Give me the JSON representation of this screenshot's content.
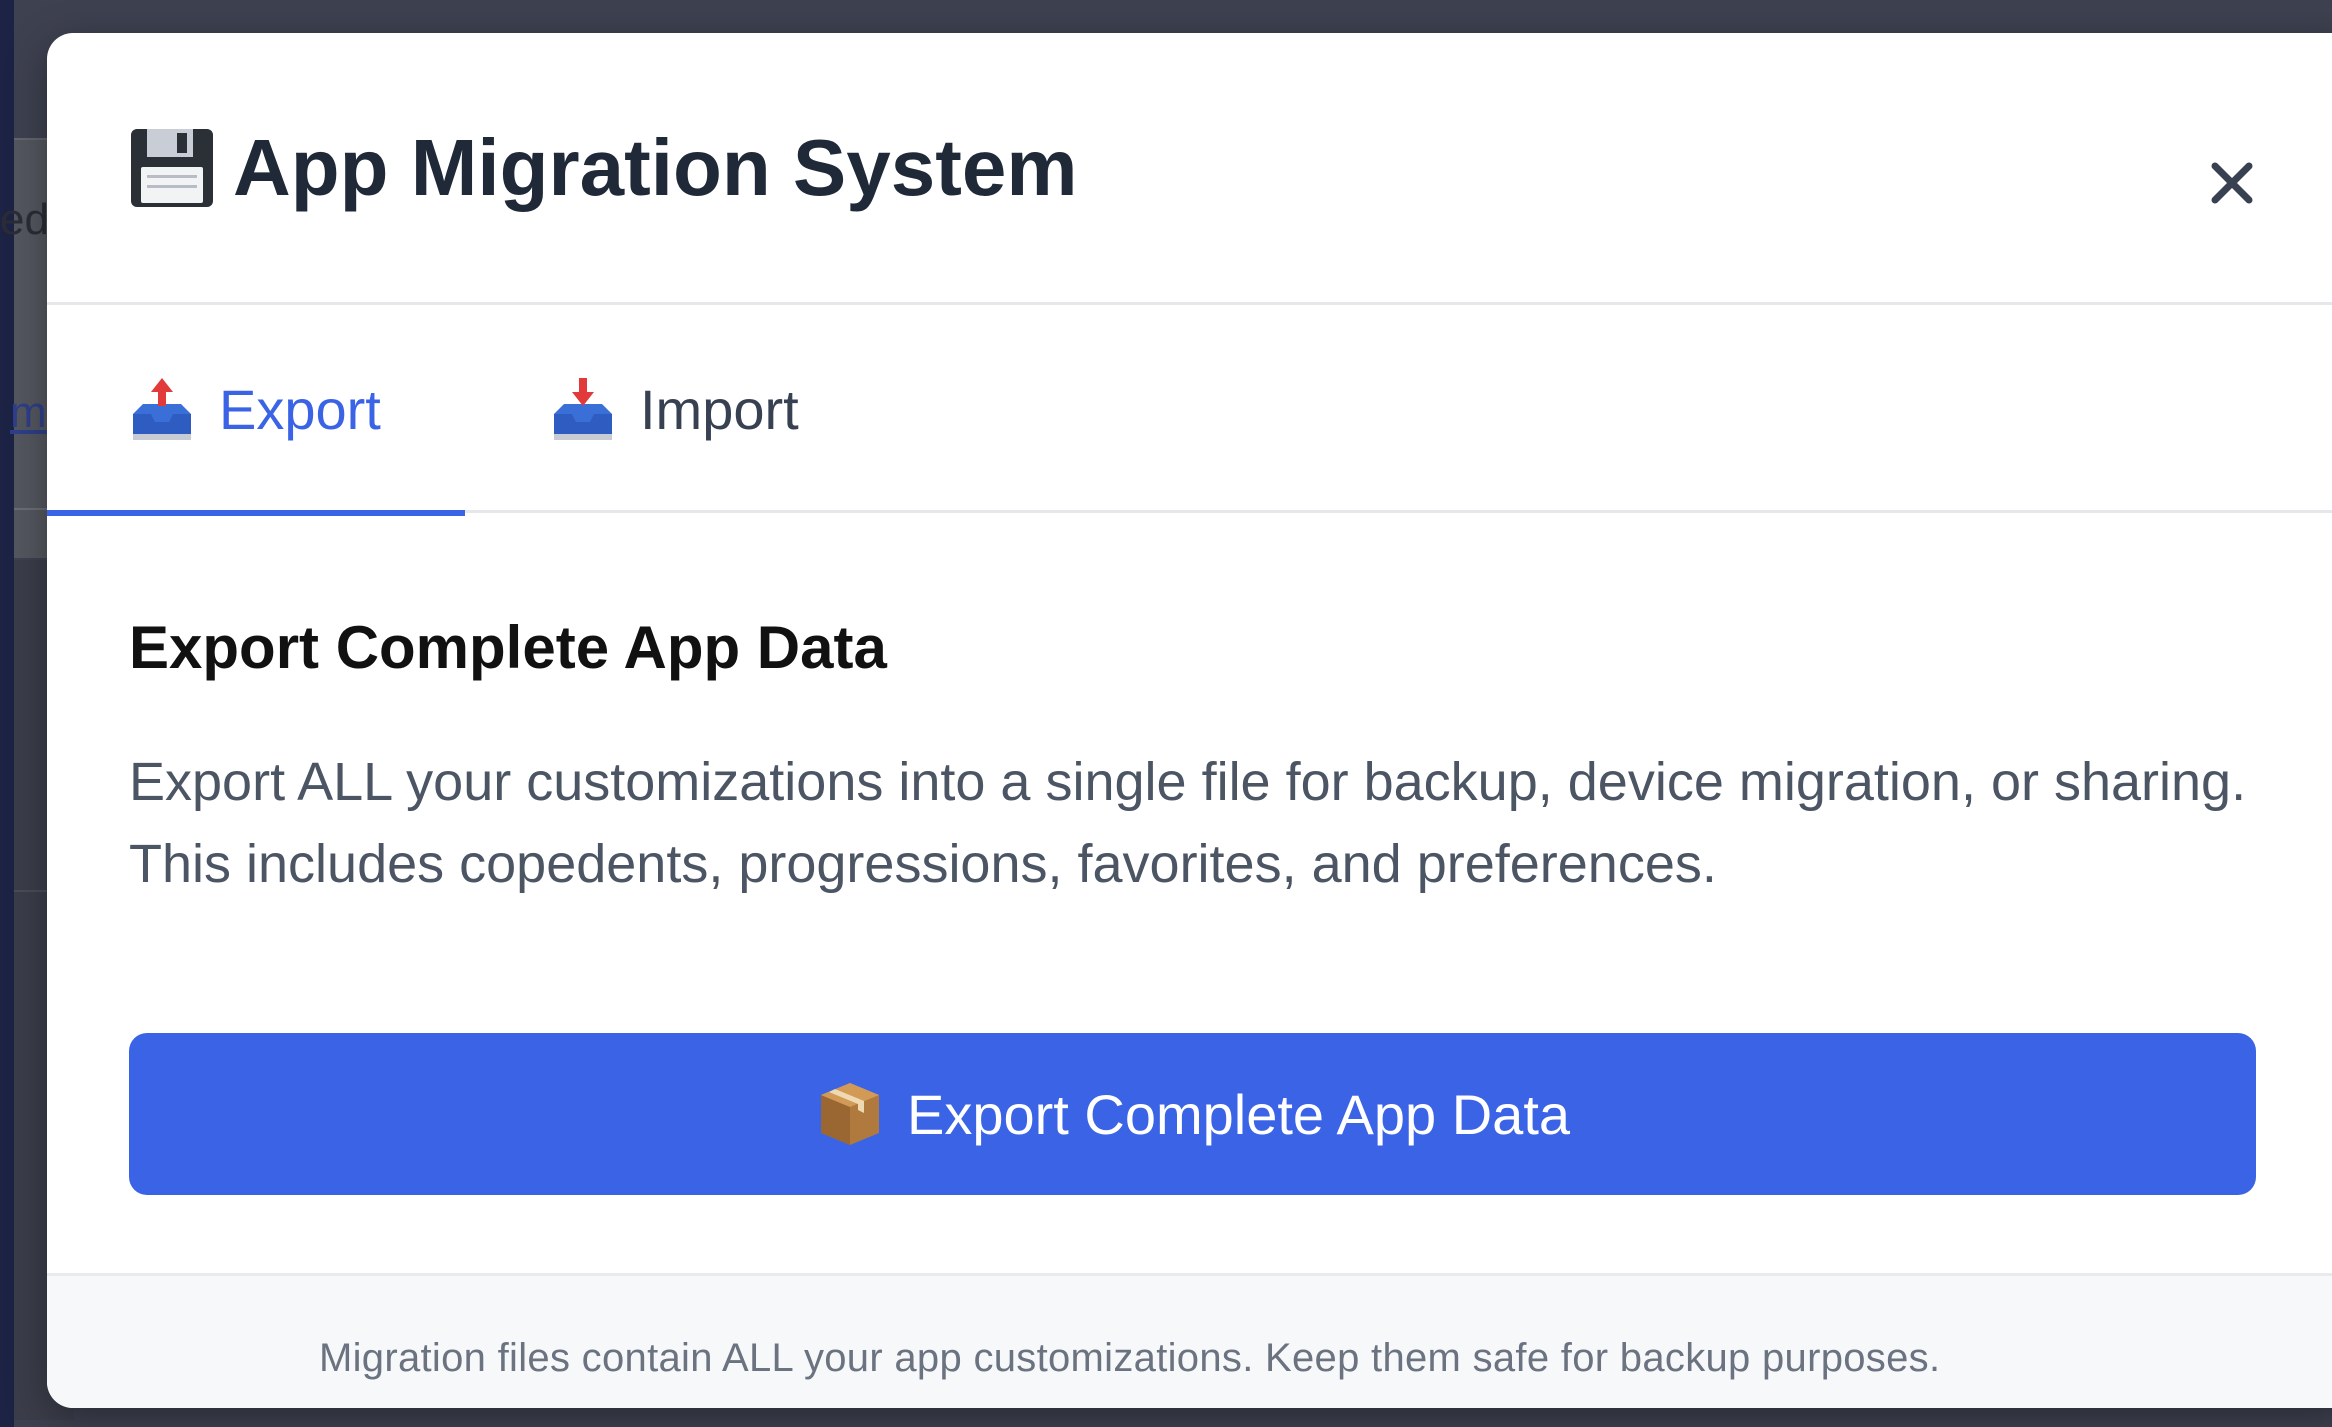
{
  "background": {
    "partial_text_1": "ed",
    "partial_link_1": "m"
  },
  "modal": {
    "title": "App Migration System",
    "title_icon": "floppy-disk-icon",
    "close_label": "×",
    "tabs": [
      {
        "label": "Export",
        "icon": "outbox-tray-icon",
        "active": true
      },
      {
        "label": "Import",
        "icon": "inbox-tray-icon",
        "active": false
      }
    ],
    "export": {
      "heading": "Export Complete App Data",
      "description": "Export ALL your customizations into a single file for backup, device migration, or sharing. This includes copedents, progressions, favorites, and preferences.",
      "button_label": "Export Complete App Data",
      "button_icon": "package-icon"
    },
    "footer_note": "Migration files contain ALL your app customizations. Keep them safe for backup purposes."
  },
  "colors": {
    "accent": "#3b63e6",
    "title_text": "#1f2937",
    "body_text": "#4b5563",
    "muted_text": "#6b7280",
    "footer_bg": "#f7f8fa"
  }
}
